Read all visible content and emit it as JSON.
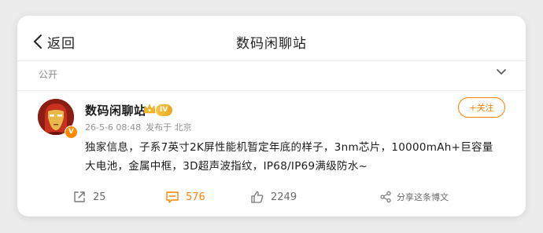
{
  "header": {
    "back_label": "返回",
    "title": "数码闲聊站"
  },
  "visibility": {
    "label": "公开"
  },
  "post": {
    "author": "数码闲聊站",
    "level_badge": "IV",
    "verified_badge": "V",
    "timestamp": "26-5-6 08:48",
    "location": "发布于 北京",
    "follow_label": "+关注",
    "text": "独家信息，子系7英寸2K屏性能机暂定年底的样子，3nm芯片，10000mAh+巨容量大电池，金属中框，3D超声波指纹，IP68/IP69满级防水~"
  },
  "actions": {
    "repost_count": "25",
    "comment_count": "576",
    "like_count": "2249",
    "share_label": "分享这条博文"
  },
  "colors": {
    "accent": "#ff8200",
    "badge_gold": "#f6c648"
  }
}
